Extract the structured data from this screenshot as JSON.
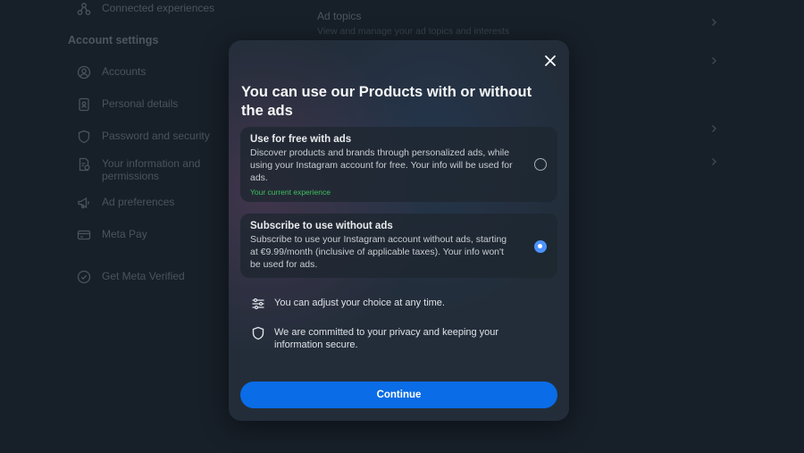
{
  "sidebar": {
    "top_item": {
      "label": "Connected experiences",
      "icon": "connected-icon"
    },
    "section_title": "Account settings",
    "items": [
      {
        "label": "Accounts",
        "icon": "account-icon"
      },
      {
        "label": "Personal details",
        "icon": "id-card-icon"
      },
      {
        "label": "Password and security",
        "icon": "shield-icon"
      },
      {
        "label": "Your information and permissions",
        "icon": "info-doc-icon"
      },
      {
        "label": "Ad preferences",
        "icon": "megaphone-icon"
      },
      {
        "label": "Meta Pay",
        "icon": "card-icon"
      },
      {
        "label": "Get Meta Verified",
        "icon": "verified-icon"
      }
    ]
  },
  "main": {
    "ad_topics_title": "Ad topics",
    "ad_topics_subtitle": "View and manage your ad topics and interests"
  },
  "dialog": {
    "title": "You can use our Products with or without the ads",
    "options": [
      {
        "title": "Use for free with ads",
        "description": "Discover products and brands through personalized ads, while using your Instagram account for free. Your info will be used for ads.",
        "current_label": "Your current experience",
        "selected": false
      },
      {
        "title": "Subscribe to use without ads",
        "description": "Subscribe to use your Instagram account without ads, starting at €9.99/month (inclusive of applicable taxes). Your info won't be used for ads.",
        "selected": true
      }
    ],
    "info": [
      {
        "icon": "sliders-icon",
        "text": "You can adjust your choice at any time."
      },
      {
        "icon": "shield-icon",
        "text": "We are committed to your privacy and keeping your information secure."
      }
    ],
    "continue_label": "Continue"
  },
  "colors": {
    "accent": "#0a6ce6",
    "radio_selected": "#4c92ff",
    "current_experience": "#3fbf5f",
    "background": "#1c2631"
  }
}
